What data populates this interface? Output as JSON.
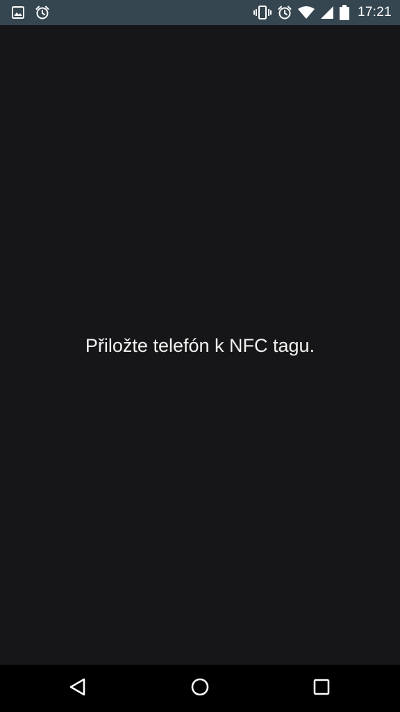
{
  "status_bar": {
    "time": "17:21",
    "left_icons": [
      "image-notification-icon",
      "alarm-notification-icon"
    ],
    "right_icons": [
      "vibrate-icon",
      "alarm-icon",
      "wifi-icon",
      "cell-signal-icon",
      "battery-icon"
    ],
    "background_color": "#354650"
  },
  "main": {
    "message": "Přiložte telefón k NFC tagu.",
    "background_color": "#161618",
    "text_color": "#f2f2f2"
  },
  "nav_bar": {
    "buttons": [
      "back-icon",
      "home-icon",
      "recents-icon"
    ],
    "background_color": "#000000"
  }
}
